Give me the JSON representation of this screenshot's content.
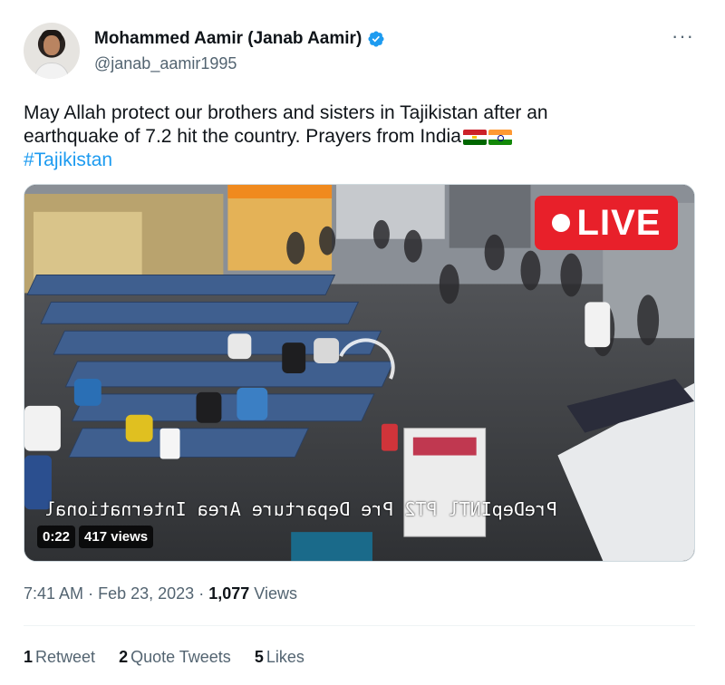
{
  "author": {
    "display_name": "Mohammed Aamir (Janab Aamir)",
    "handle": "@janab_aamir1995",
    "verified": true
  },
  "menu_icon": "more-horizontal-icon",
  "tweet": {
    "text_line1": "May Allah protect our brothers and sisters in Tajikistan after an",
    "text_line2": "earthquake of 7.2 hit the country. Prayers from India",
    "flags": [
      "flag-tajikistan",
      "flag-india"
    ],
    "hashtag": "#Tajikistan"
  },
  "media": {
    "live_label": "LIVE",
    "duration": "0:22",
    "views": "417 views",
    "overlay_text": "PreDepINTl PT2  Pre Departure Area International"
  },
  "meta": {
    "time": "7:41 AM",
    "separator": "·",
    "date": "Feb 23, 2023",
    "views_count": "1,077",
    "views_label": "Views"
  },
  "stats": [
    {
      "count": "1",
      "label": "Retweet"
    },
    {
      "count": "2",
      "label": "Quote Tweets"
    },
    {
      "count": "5",
      "label": "Likes"
    }
  ],
  "colors": {
    "accent": "#1d9bf0",
    "text": "#0f1419",
    "muted": "#536471",
    "live": "#e8202a"
  }
}
